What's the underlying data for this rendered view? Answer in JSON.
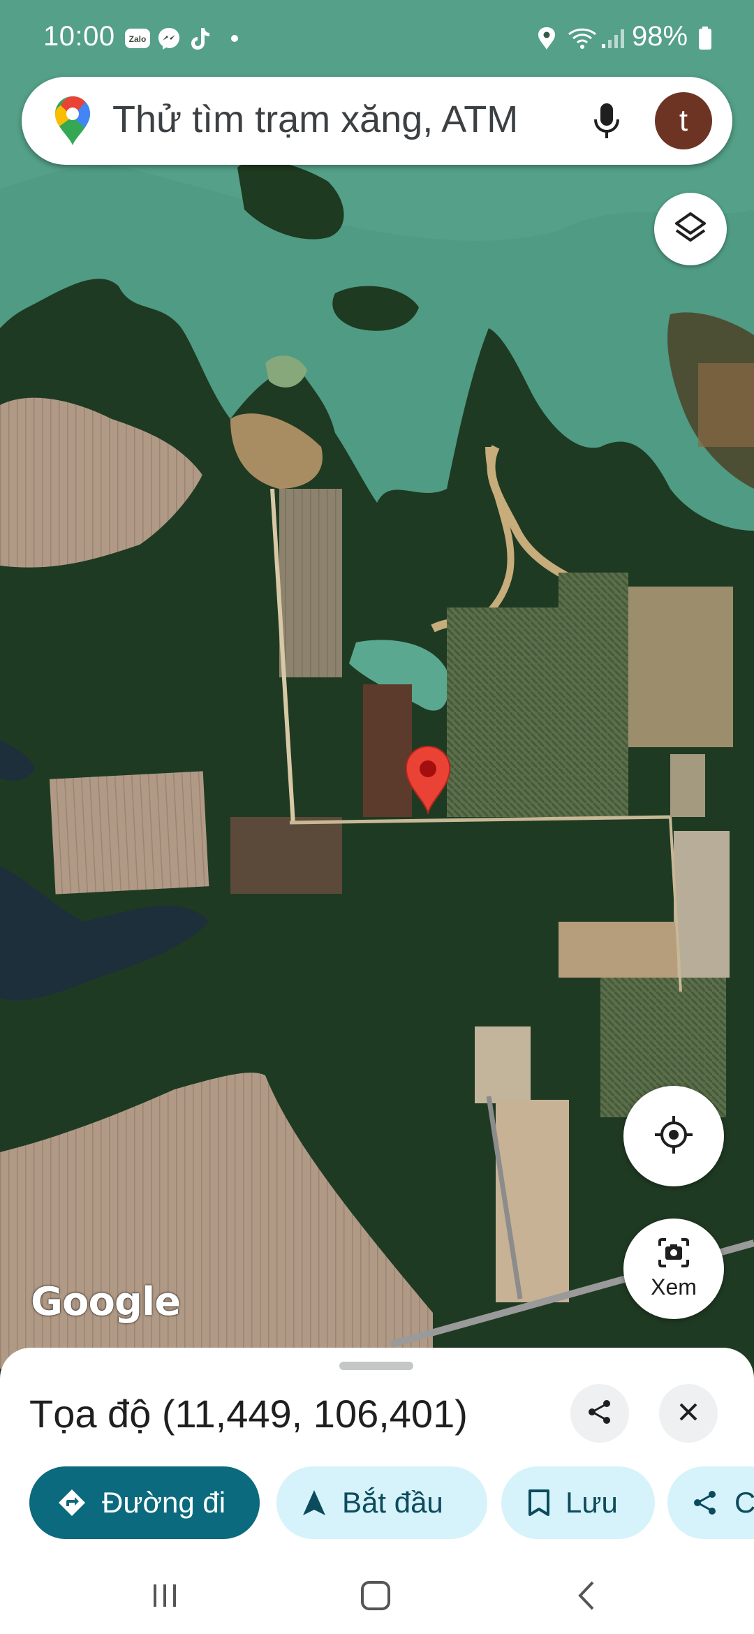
{
  "status_bar": {
    "time": "10:00",
    "notification_icons": [
      "zalo-icon",
      "messenger-icon",
      "tiktok-icon",
      "dot-icon"
    ],
    "zalo_label": "Zalo",
    "battery": "98%"
  },
  "search": {
    "placeholder": "Thử tìm trạm xăng, ATM",
    "avatar_initial": "t"
  },
  "map": {
    "attribution": "Google",
    "pin_color": "#ea4335"
  },
  "lens": {
    "label": "Xem"
  },
  "sheet": {
    "title": "Tọa độ (11,449, 106,401)",
    "actions": [
      {
        "label": "Đường đi",
        "icon": "directions-icon",
        "primary": true
      },
      {
        "label": "Bắt đầu",
        "icon": "navigation-arrow-icon",
        "primary": false
      },
      {
        "label": "Lưu",
        "icon": "bookmark-icon",
        "primary": false
      },
      {
        "label": "C",
        "icon": "share-icon",
        "primary": false
      }
    ]
  },
  "colors": {
    "primary_chip": "#0b6a7d",
    "secondary_chip": "#d6f3fb",
    "avatar": "#6d3424"
  }
}
